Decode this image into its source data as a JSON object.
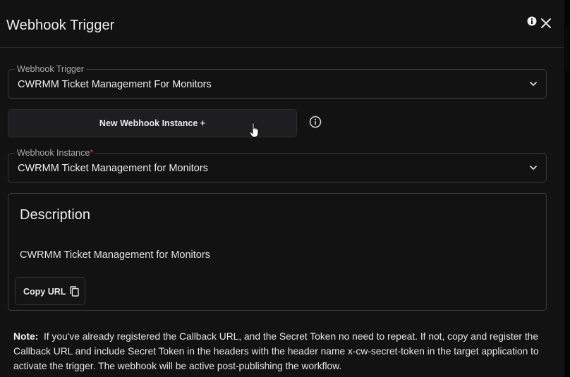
{
  "header": {
    "title": "Webhook Trigger",
    "icons": [
      "info-icon",
      "close-icon"
    ]
  },
  "trigger_field": {
    "label": "Webhook Trigger",
    "value": "CWRMM Ticket Management For Monitors"
  },
  "new_instance_button": {
    "label": "New Webhook Instance +"
  },
  "instance_field": {
    "label": "Webhook Instance",
    "required_mark": "*",
    "value": "CWRMM Ticket Management for Monitors"
  },
  "description": {
    "title": "Description",
    "text": "CWRMM Ticket Management for Monitors",
    "copy_button_label": "Copy URL"
  },
  "note": {
    "label": "Note:",
    "text": "If you've already registered the Callback URL, and the Secret Token no need to repeat. If not, copy and register the Callback URL and include Secret Token in the headers with the header name x-cw-secret-token in the target application to activate the trigger. The webhook will be active post-publishing the workflow."
  },
  "colors": {
    "background": "#121213",
    "border": "#3a3a3d",
    "button": "#1e1e20",
    "required": "#e23b3b"
  }
}
